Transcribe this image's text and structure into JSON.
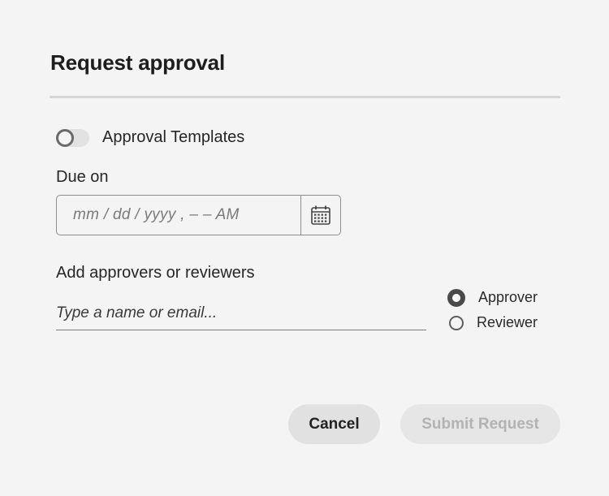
{
  "dialog": {
    "title": "Request approval"
  },
  "approval_templates": {
    "label": "Approval Templates",
    "enabled": false
  },
  "due_on": {
    "label": "Due on",
    "placeholder": "mm / dd / yyyy ,  – –  AM",
    "calendar_icon": "calendar-icon"
  },
  "approvers": {
    "label": "Add approvers or reviewers",
    "placeholder": "Type a name or email..."
  },
  "role": {
    "options": [
      {
        "label": "Approver",
        "selected": true
      },
      {
        "label": "Reviewer",
        "selected": false
      }
    ]
  },
  "actions": {
    "cancel_label": "Cancel",
    "submit_label": "Submit Request",
    "submit_disabled": true
  }
}
